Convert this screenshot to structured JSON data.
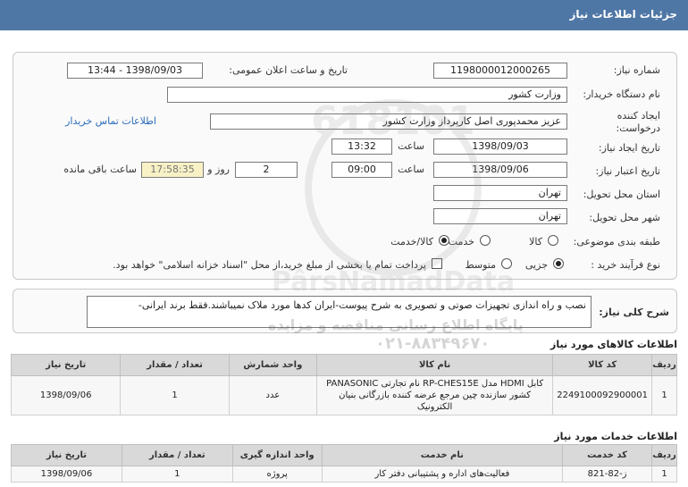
{
  "header": {
    "title": "جزئیات اطلاعات نیاز"
  },
  "form": {
    "need_number_label": "شماره نیاز:",
    "need_number": "1198000012000265",
    "announce_label": "تاریخ و ساعت اعلان عمومی:",
    "announce_value": "1398/09/03 - 13:44",
    "buyer_org_label": "نام دستگاه خریدار:",
    "buyer_org": "وزارت کشور",
    "creator_label_1": "ایجاد کننده",
    "creator_label_2": "درخواست:",
    "creator": "عزیز محمدپوری اصل کارپرداز وزارت کشور",
    "contact_link": "اطلاعات تماس خریدار",
    "created_date_label": "تاریخ ایجاد نیاز:",
    "created_date": "1398/09/03",
    "time_label": "ساعت",
    "created_time": "13:32",
    "valid_date_label": "تاریخ اعتبار نیاز:",
    "valid_date": "1398/09/06",
    "valid_time": "09:00",
    "days": "2",
    "days_label": "روز و",
    "remaining": "17:58:35",
    "remaining_label": "ساعت باقی مانده",
    "province_label": "استان محل تحویل:",
    "province": "تهران",
    "city_label": "شهر محل تحویل:",
    "city": "تهران",
    "category_label": "طبقه بندی موضوعی:",
    "category_options": [
      "کالا",
      "خدمت",
      "کالا/خدمت"
    ],
    "category_selected": "کالا/خدمت",
    "process_label": "نوع فرآیند خرید :",
    "process_options": [
      "جزیی",
      "متوسط"
    ],
    "process_selected": "جزیی",
    "payment_note": "پرداخت تمام یا بخشی از مبلغ خرید،از محل \"اسناد خزانه اسلامی\" خواهد بود."
  },
  "description": {
    "label": "شرح کلی نیاز:",
    "text": "نصب و راه اندازی تجهیزات صوتی و تصویری به شرح پیوست-ایران کدها مورد ملاک نمیباشند.فقط برند ایرانی-"
  },
  "goods": {
    "title": "اطلاعات کالاهای مورد نیاز",
    "columns": [
      "ردیف",
      "کد کالا",
      "نام کالا",
      "واحد شمارش",
      "تعداد / مقدار",
      "تاریخ نیاز"
    ],
    "rows": [
      [
        "1",
        "2249100092900001",
        "کابل HDMI مدل RP-CHES15E نام تجارتی PANASONIC کشور سازنده چین مرجع عرضه کننده بازرگانی بنیان الکترونیک",
        "عدد",
        "1",
        "1398/09/06"
      ]
    ]
  },
  "services": {
    "title": "اطلاعات خدمات مورد نیاز",
    "columns": [
      "ردیف",
      "کد خدمت",
      "نام خدمت",
      "واحد اندازه گیری",
      "تعداد / مقدار",
      "تاریخ نیاز"
    ],
    "rows": [
      [
        "1",
        "ز-82-821",
        "فعالیت‌های اداره و پشتیبانی دفتر کار",
        "پروژه",
        "1",
        "1398/09/06"
      ]
    ]
  },
  "watermark": {
    "line1": "پایگاه اطلاع رسانی مناقصه و مزایده",
    "line2": "PârsNamadData",
    "line3": "۰۲۱-۸۸۳۴۹۶۷۰",
    "digits": "618101"
  }
}
